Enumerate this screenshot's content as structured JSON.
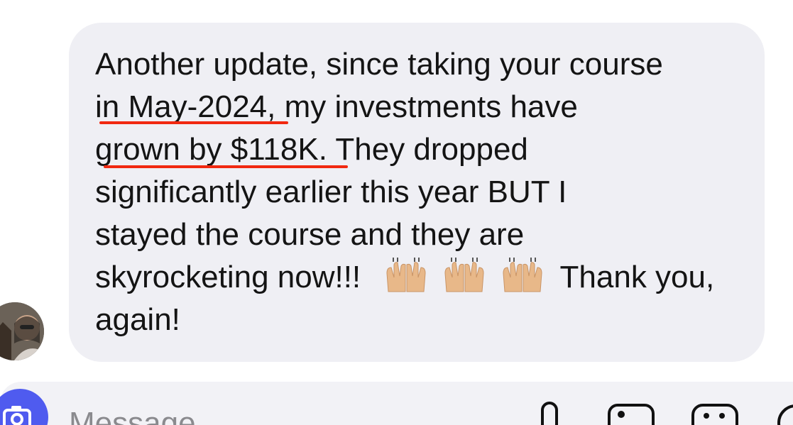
{
  "message": {
    "lines": [
      "Another update, since taking your course",
      "in May-2024, my investments have",
      "grown by $118K. They dropped",
      "significantly earlier this year BUT I",
      "stayed the course and they are",
      "skyrocketing now!!!",
      "Thank you,",
      "again!"
    ],
    "emoji_name": "raising-hands-light-skin-emoji",
    "emoji_count": 3
  },
  "composer": {
    "placeholder": "Message"
  },
  "icons": {
    "microphone": "microphone-icon",
    "photo": "photo-icon",
    "sticker": "sticker-icon",
    "camera": "camera-icon",
    "avatar": "avatar"
  },
  "colors": {
    "bubble": "#efeff4",
    "text": "#141414",
    "underline": "#f12810",
    "camera_button": "#4f5bef"
  }
}
